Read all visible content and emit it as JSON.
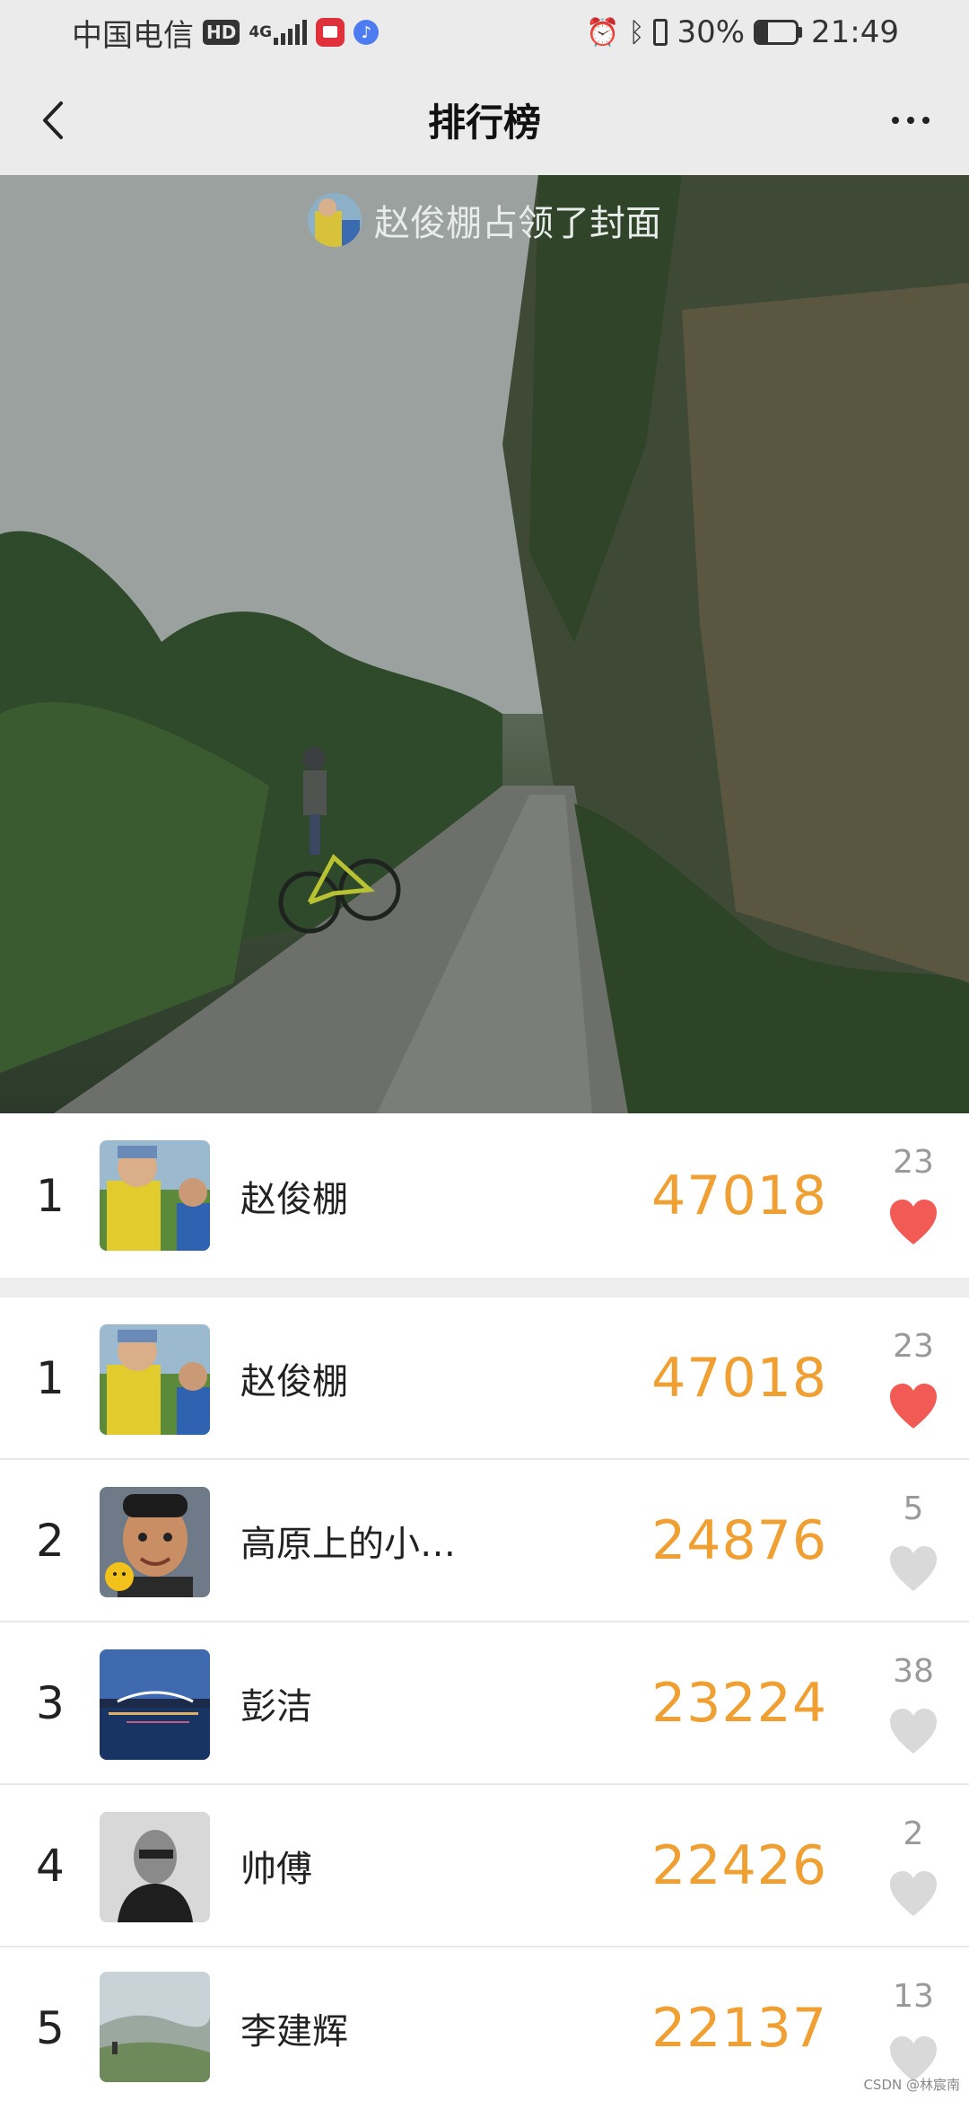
{
  "status_bar": {
    "carrier": "中国电信",
    "hd": "HD",
    "network": "4G",
    "battery_percent": "30%",
    "battery_level": 0.3,
    "time": "21:49",
    "icons": [
      "hd-badge",
      "4g-signal-icon",
      "signal-bars-icon",
      "red-app-notification-icon",
      "music-notification-icon",
      "alarm-icon",
      "bluetooth-icon",
      "vibrate-icon",
      "battery-icon"
    ]
  },
  "header": {
    "title": "排行榜",
    "back_icon": "chevron-left-icon",
    "more_icon": "more-dots-icon"
  },
  "cover": {
    "occupant_text": "赵俊棚占领了封面"
  },
  "my_rank": {
    "rank": "1",
    "name": "赵俊棚",
    "steps": "47018",
    "likes": "23",
    "liked": true
  },
  "rankings": [
    {
      "rank": "1",
      "name": "赵俊棚",
      "steps": "47018",
      "likes": "23",
      "liked": true
    },
    {
      "rank": "2",
      "name": "高原上的小…",
      "steps": "24876",
      "likes": "5",
      "liked": false
    },
    {
      "rank": "3",
      "name": "彭洁",
      "steps": "23224",
      "likes": "38",
      "liked": false
    },
    {
      "rank": "4",
      "name": "帅傅",
      "steps": "22426",
      "likes": "2",
      "liked": false
    },
    {
      "rank": "5",
      "name": "李建辉",
      "steps": "22137",
      "likes": "13",
      "liked": false
    }
  ],
  "watermark": "CSDN @林宸南",
  "colors": {
    "steps": "#f0a032",
    "heart_liked": "#f25a55",
    "heart_unliked": "#d9d9d9",
    "header_bg": "#ebebeb"
  }
}
